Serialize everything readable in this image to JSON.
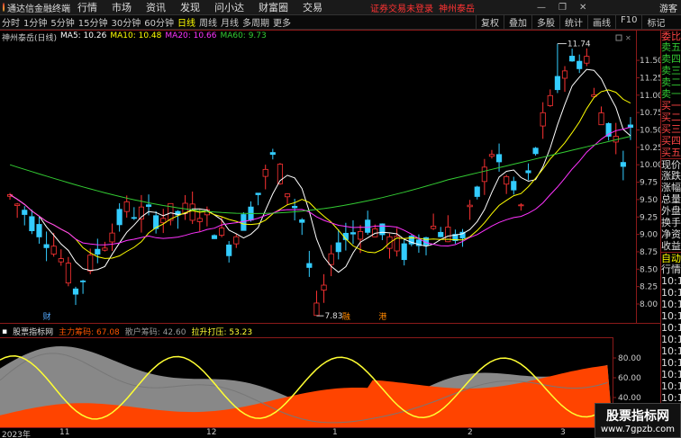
{
  "topbar": {
    "app_title": "通达信金融终端",
    "menu": [
      "行情",
      "市场",
      "资讯",
      "发现",
      "问小达",
      "财富圈",
      "交易"
    ],
    "notice": "证券交易未登录",
    "stock": "神州泰岳",
    "guest": "游客"
  },
  "periodbar": {
    "periods": [
      "分时",
      "1分钟",
      "5分钟",
      "15分钟",
      "30分钟",
      "60分钟",
      "日线",
      "周线",
      "月线",
      "多周期",
      "更多"
    ],
    "active": "日线",
    "tools": [
      "复权",
      "叠加",
      "多股",
      "统计",
      "画线",
      "F10",
      "标记"
    ]
  },
  "legend": {
    "name": "神州泰岳(日线)",
    "ma": [
      {
        "label": "MA5: 10.26",
        "color": "#ffffff"
      },
      {
        "label": "MA10: 10.48",
        "color": "#ffff00"
      },
      {
        "label": "MA20: 10.66",
        "color": "#ff33ff"
      },
      {
        "label": "MA60: 9.73",
        "color": "#33cc33"
      }
    ]
  },
  "price_axis": [
    "11.50",
    "11.25",
    "11.00",
    "10.75",
    "10.50",
    "10.25",
    "10.00",
    "9.75",
    "9.50",
    "9.25",
    "9.00",
    "8.75",
    "8.50",
    "8.25",
    "8.00"
  ],
  "annotations": {
    "high": "11.74",
    "low": "7.83",
    "markers": [
      "财",
      "融",
      "港"
    ]
  },
  "indicator": {
    "name": "股票指标网",
    "main_label": "主力筹码: 67.08",
    "retail_label": "散户筹码: 42.60",
    "pull_label": "拉升打压: 53.23",
    "axis": [
      "80.00",
      "60.00",
      "40.00"
    ]
  },
  "time_axis": [
    "2023年",
    "11",
    "12",
    "1",
    "2",
    "3"
  ],
  "right_panel": [
    "委比",
    "卖五",
    "卖四",
    "卖三",
    "卖二",
    "卖一",
    "买一",
    "买二",
    "买三",
    "买四",
    "买五",
    "现价",
    "涨跌",
    "涨幅",
    "总量",
    "外盘",
    "换手",
    "净资",
    "收益",
    "自动",
    "行情",
    "10:1",
    "10:1",
    "10:1",
    "10:1",
    "10:1",
    "10:1",
    "10:1",
    "10:1",
    "10:1",
    "10:1",
    "10:1"
  ],
  "watermark": {
    "title": "股票指标网",
    "url": "www.7gpzb.com"
  },
  "colors": {
    "up": "#ff3333",
    "down": "#33ccff",
    "frame": "#8b1a1a",
    "ma5": "#ffffff",
    "ma10": "#ffff00",
    "ma20": "#ff33ff",
    "ma60": "#33cc33",
    "main_fill": "#ff4400",
    "retail_fill": "#888888",
    "retail_line": "#777777",
    "pull_line": "#ffff33"
  }
}
